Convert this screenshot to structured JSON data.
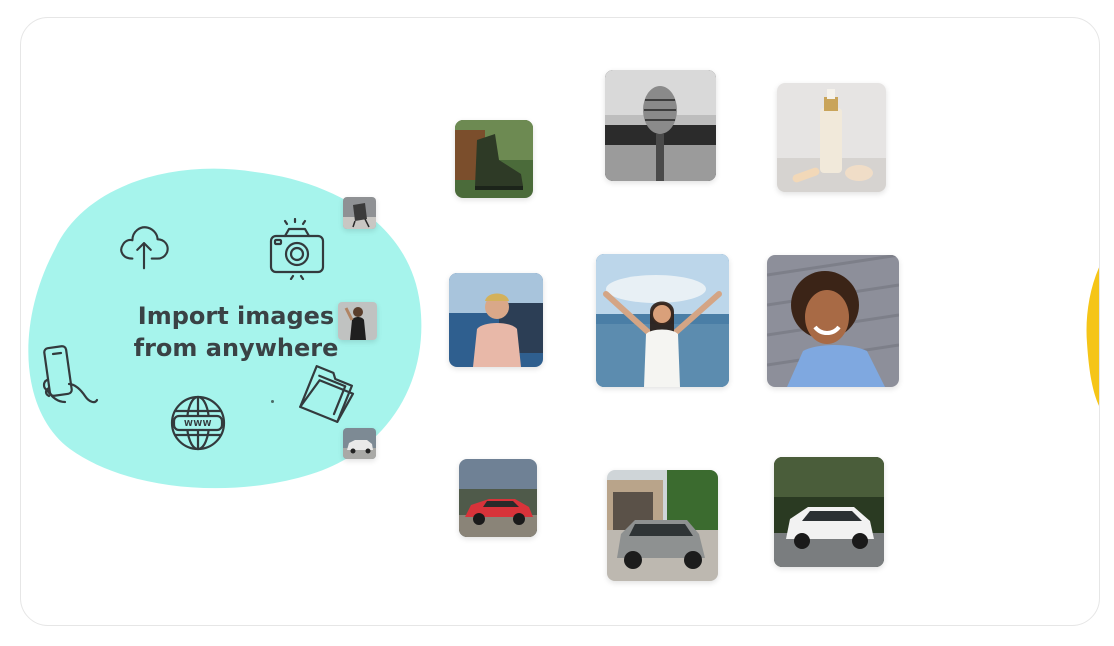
{
  "headline": {
    "line1": "Import images",
    "line2": "from anywhere"
  },
  "icons": [
    "cloud-upload-icon",
    "camera-icon",
    "phone-in-hand-icon",
    "globe-www-icon",
    "folder-icon"
  ],
  "globe_label": "WWW",
  "colors": {
    "blob": "#a6f4ec",
    "icon_stroke": "#333a3d",
    "text": "#3a4245",
    "accent_yellow": "#f5c518"
  }
}
